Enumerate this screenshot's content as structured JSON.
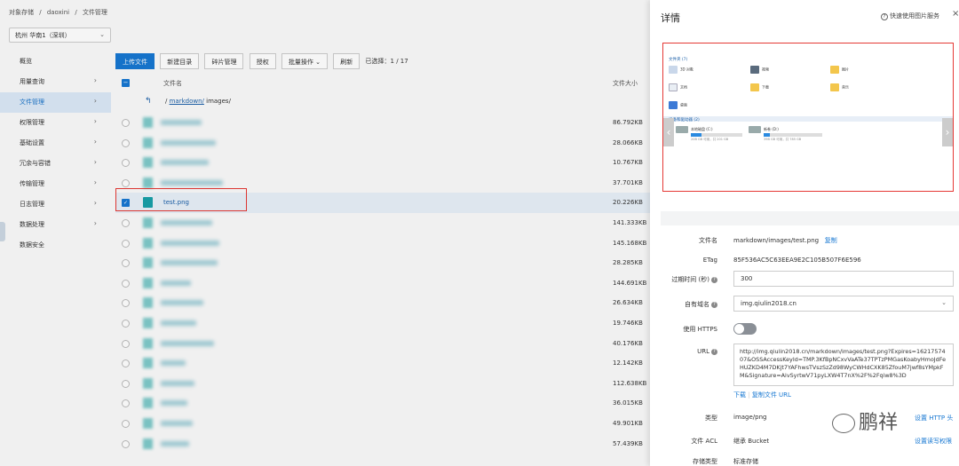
{
  "breadcrumb": [
    "对象存储",
    "/",
    "daoxini",
    "/",
    "文件管理"
  ],
  "region": "杭州 华南1（深圳）",
  "sidebar": [
    {
      "label": "概览",
      "arrow": ""
    },
    {
      "label": "用量查询",
      "arrow": "›"
    },
    {
      "label": "文件管理",
      "arrow": "›",
      "active": true
    },
    {
      "label": "权限管理",
      "arrow": "›"
    },
    {
      "label": "基础设置",
      "arrow": "›"
    },
    {
      "label": "冗余与容错",
      "arrow": "›"
    },
    {
      "label": "传输管理",
      "arrow": "›"
    },
    {
      "label": "日志管理",
      "arrow": "›"
    },
    {
      "label": "数据处理",
      "arrow": "›"
    },
    {
      "label": "数据安全",
      "arrow": ""
    }
  ],
  "toolbar": {
    "upload": "上传文件",
    "new_dir": "新建目录",
    "fragments": "碎片管理",
    "authorize": "授权",
    "batch": "批量操作",
    "refresh": "刷新",
    "selected_label": "已选择：",
    "selected_count": "1",
    "total": "/ 17"
  },
  "table": {
    "col_name": "文件名",
    "col_size": "文件大小",
    "path_prefix": "/",
    "path_link": "markdown/",
    "path_rest": "images/",
    "rows": [
      {
        "size": "86.792KB",
        "w": 46
      },
      {
        "size": "28.066KB",
        "w": 62
      },
      {
        "size": "10.767KB",
        "w": 54
      },
      {
        "size": "37.701KB",
        "w": 70
      },
      {
        "size": "20.226KB",
        "name": "test.png",
        "selected": true
      },
      {
        "size": "141.333KB",
        "w": 58
      },
      {
        "size": "145.168KB",
        "w": 66
      },
      {
        "size": "28.285KB",
        "w": 64
      },
      {
        "size": "144.691KB",
        "w": 34
      },
      {
        "size": "26.634KB",
        "w": 48
      },
      {
        "size": "19.746KB",
        "w": 40
      },
      {
        "size": "40.176KB",
        "w": 60
      },
      {
        "size": "12.142KB",
        "w": 28
      },
      {
        "size": "112.638KB",
        "w": 38
      },
      {
        "size": "36.015KB",
        "w": 30
      },
      {
        "size": "49.901KB",
        "w": 36
      },
      {
        "size": "57.439KB",
        "w": 32
      }
    ]
  },
  "panel": {
    "title": "详情",
    "help": "快速使用图片服务",
    "close": "×",
    "preview": {
      "folders_header": "文件夹 (7)",
      "folders": [
        "3D 对象",
        "视频",
        "图片",
        "文档",
        "下载",
        "音乐",
        "桌面"
      ],
      "drives_header": "设备和驱动器 (2)",
      "drive_c": "本地磁盘 (C:)",
      "drive_c_free": "20B GB 可用，共 201 GB",
      "drive_d": "新卷 (D:)",
      "drive_d_free": "39B GB 可用，共 785 GB"
    },
    "fields": {
      "filename_label": "文件名",
      "filename": "markdown/images/test.png",
      "copy": "复制",
      "etag_label": "ETag",
      "etag": "85F536AC5C63EEA9E2C105B507F6E596",
      "expire_label": "过期时间 (秒)",
      "expire": "300",
      "domain_label": "自有域名",
      "domain": "img.qiulin2018.cn",
      "https_label": "使用 HTTPS",
      "url_label": "URL",
      "url": "http://img.qiulin2018.cn/markdown/images/test.png?Expires=1621757407&OSSAccessKeyId=TMP.3KfBpNCxvVaATe37TPTzPMGasKoabyHmoJdFeHUZKD4M7DKjt7YAFhwsTVszSzZd98WyCWHdCXK85ZfouM7jwf8sYMpkFM&Signature=AivSyrtwV71pyLXW4T7nX%2F%2Fqiw8%3D",
      "download": "下载",
      "copy_url": "复制文件 URL",
      "type_label": "类型",
      "type": "image/png",
      "http_head": "设置 HTTP 头",
      "acl_label": "文件 ACL",
      "acl": "继承 Bucket",
      "acl_link": "设置读写权限",
      "storage_label": "存储类型",
      "storage": "标准存储"
    },
    "watermark": "鹏祥"
  }
}
